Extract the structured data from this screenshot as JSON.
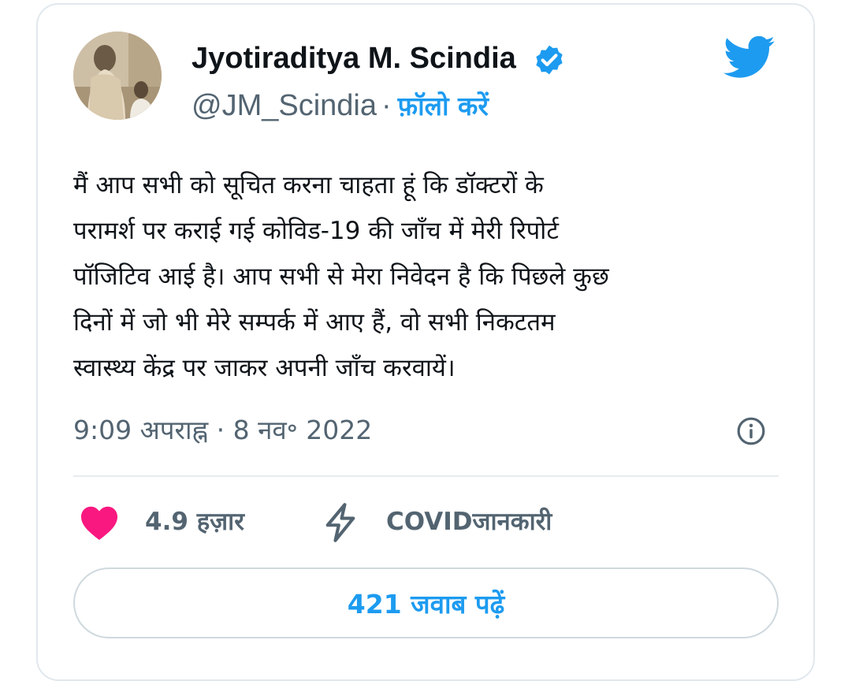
{
  "author": {
    "name": "Jyotiraditya M. Scindia",
    "handle": "@JM_Scindia",
    "separator": "·",
    "follow_label": "फ़ॉलो करें",
    "verified_icon": "verified-badge-icon",
    "avatar_icon": "avatar-photo"
  },
  "brand": {
    "logo_icon": "twitter-bird-icon",
    "accent_color": "#1d9bf0"
  },
  "tweet": {
    "lines": [
      "मैं आप सभी को सूचित करना चाहता हूं कि डॉक्टरों के",
      "परामर्श पर कराई गई कोविड-19 की जाँच में मेरी रिपोर्ट",
      "पॉजिटिव आई है। आप सभी से मेरा निवेदन है कि पिछले कुछ",
      "दिनों में जो भी मेरे सम्पर्क में आए हैं, वो सभी निकटतम",
      "स्वास्थ्य केंद्र पर जाकर अपनी जाँच करवायें।"
    ],
    "timestamp": "9:09 अपराह्न · 8 नव॰ 2022",
    "info_icon": "info-icon"
  },
  "actions": {
    "likes_count": "4.9 हज़ार",
    "like_icon": "heart-icon",
    "heart_color": "#f91880",
    "topic_icon": "lightning-bolt-icon",
    "topic_label": "COVIDजानकारी",
    "replies_label": "421 जवाब पढ़ें"
  }
}
